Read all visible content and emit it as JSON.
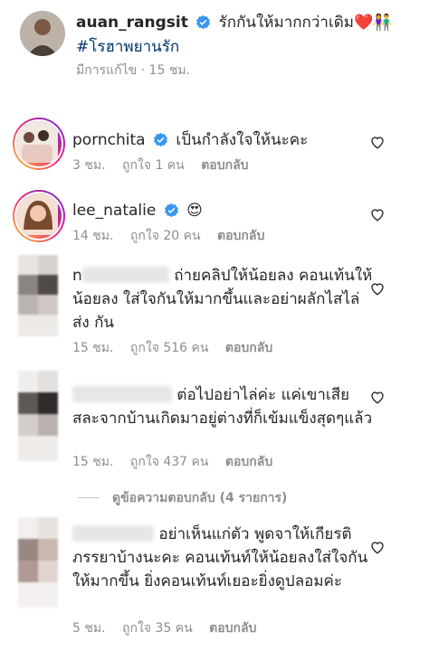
{
  "post": {
    "username": "auan_rangsit",
    "caption": "รักกันให้มากกว่าเดิม",
    "caption_emoji": "❤️👫",
    "hashtag": "#โรฮาพยานรัก",
    "meta": "มีการแก้ไข · 15 ชม."
  },
  "comments": [
    {
      "username": "pornchita",
      "text": "เป็นกำลังใจให้นะคะ",
      "time": "3 ชม.",
      "likes": "ถูกใจ 1 คน",
      "reply": "ตอบกลับ"
    },
    {
      "username": "lee_natalie",
      "text": "😍",
      "time": "14 ชม.",
      "likes": "ถูกใจ 20 คน",
      "reply": "ตอบกลับ"
    },
    {
      "username_visible": "n",
      "text": "ถ่ายคลิปให้น้อยลง คอนเท้นให้น้อยลง ใส่ใจกันให้มากขึ้นและอย่าผลักไสไล่ส่ง กัน",
      "time": "15 ชม.",
      "likes": "ถูกใจ 516 คน",
      "reply": "ตอบกลับ"
    },
    {
      "username_visible": "",
      "text": "ต่อไปอย่าไล่ค่ะ แค่เขาเสียสละจากบ้านเกิดมาอยู่ต่างที่ก็เข้มแข็งสุดๆแล้ว",
      "time": "15 ชม.",
      "likes": "ถูกใจ 437 คน",
      "reply": "ตอบกลับ"
    },
    {
      "username_visible": "",
      "text": "อย่าเห็นแก่ตัว พูดจาให้เกียรติภรรยาบ้างนะคะ คอนเท้นท์ให้น้อยลงใส่ใจกันให้มากขึ้น ยิ่งคอนเท้นท์เยอะยิ่งดูปลอมค่ะ",
      "time": "5 ชม.",
      "likes": "ถูกใจ 35 คน",
      "reply": "ตอบกลับ"
    }
  ],
  "view_replies": "ดูข้อความตอบกลับ (4 รายการ)",
  "colors": {
    "verified": "#3897f0",
    "hashtag": "#00376b",
    "meta": "#8e8e8e"
  },
  "icons": {
    "like": "heart-outline-icon",
    "verified": "verified-badge-icon"
  }
}
